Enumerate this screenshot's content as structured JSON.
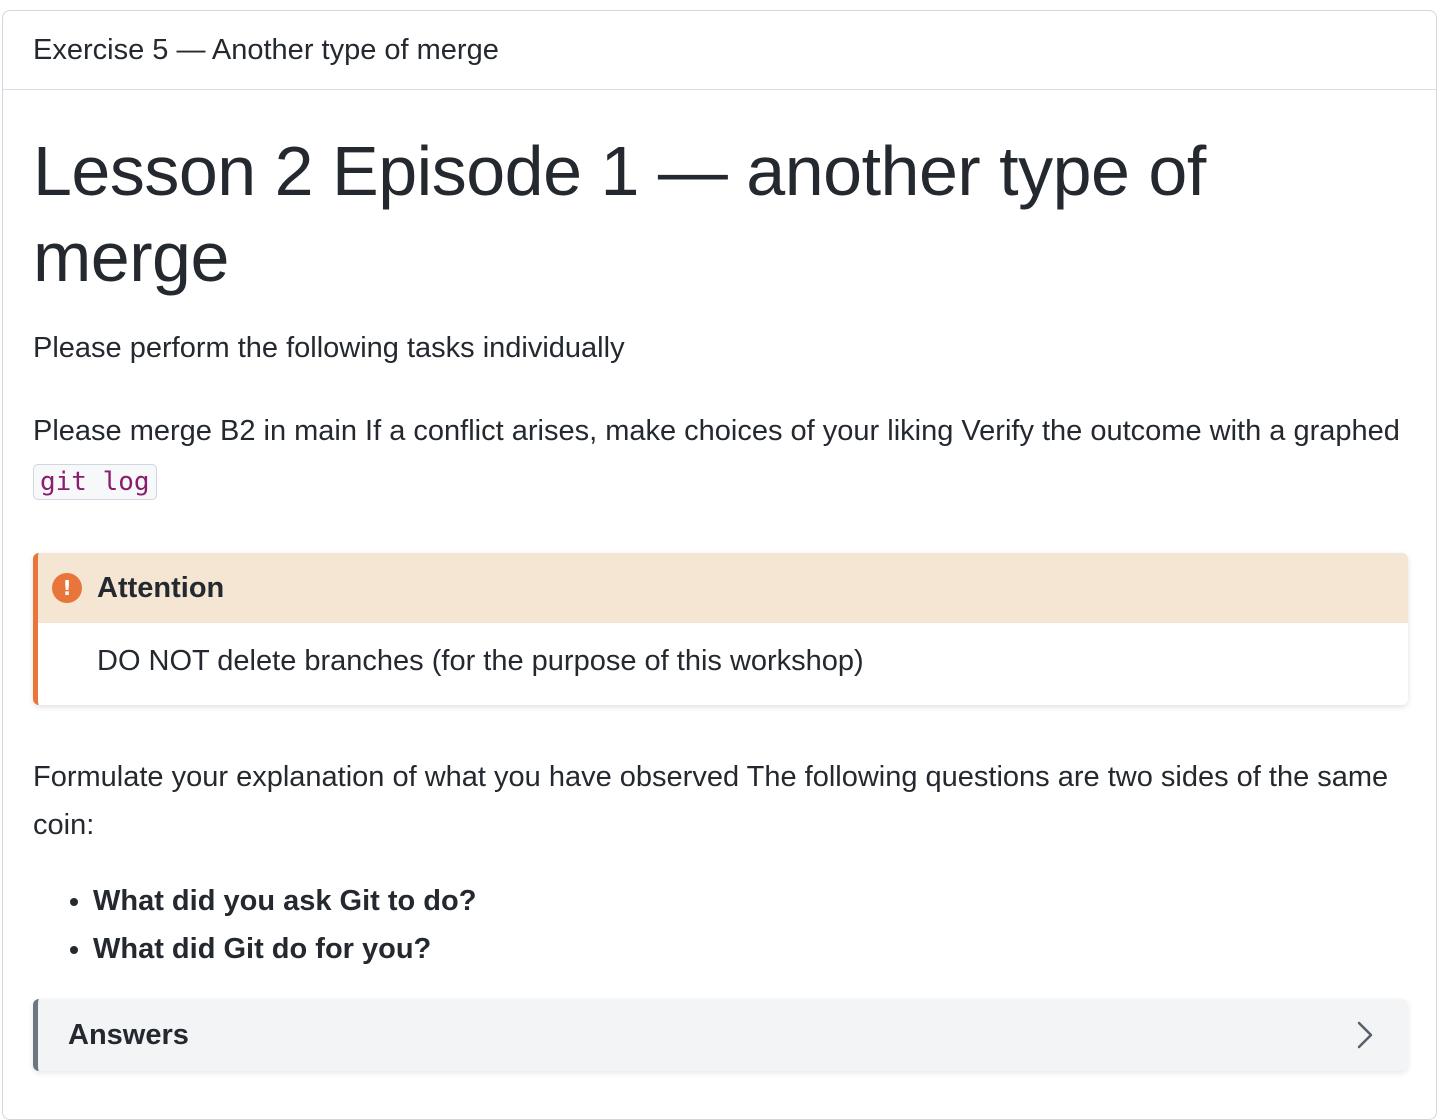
{
  "header": {
    "title": "Exercise 5 — Another type of merge"
  },
  "main": {
    "heading": "Lesson 2 Episode 1 — another type of merge",
    "intro": "Please perform the following tasks individually",
    "task_text": "Please merge B2 in main If a conflict arises, make choices of your liking Verify the outcome with a graphed ",
    "task_code": "git log",
    "admonition": {
      "title": "Attention",
      "icon": "exclamation-icon",
      "body": "DO NOT delete branches (for the purpose of this workshop)",
      "accent_color": "#e8763a"
    },
    "explanation": "Formulate your explanation of what you have observed The following questions are two sides of the same coin:",
    "questions": [
      "What did you ask Git to do?",
      "What did Git do for you?"
    ],
    "answers": {
      "label": "Answers",
      "icon": "chevron-right-icon"
    }
  }
}
